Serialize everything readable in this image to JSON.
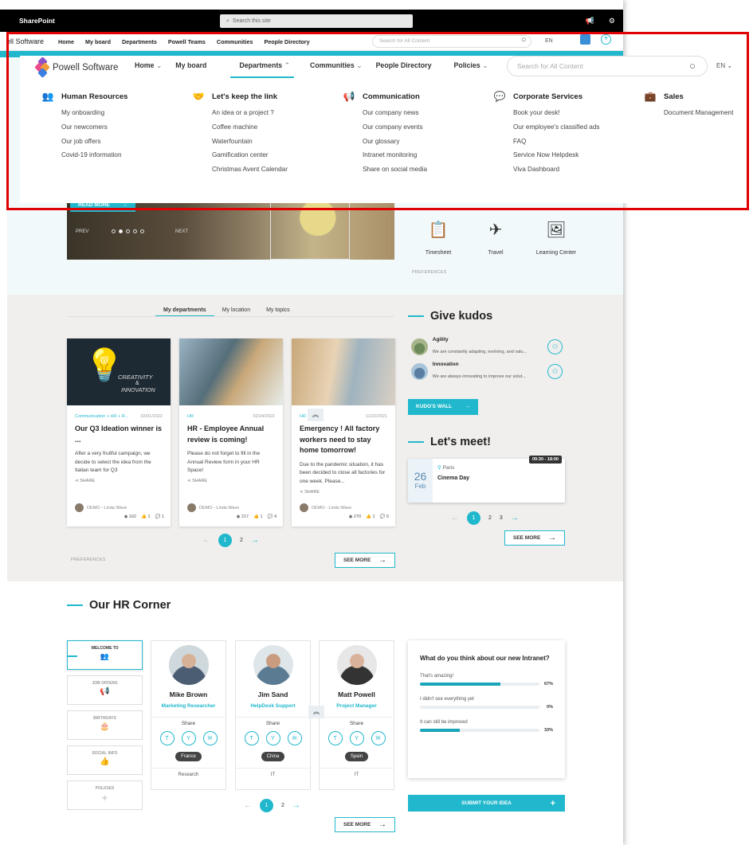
{
  "sharepoint": {
    "brand": "SharePoint",
    "search_placeholder": "Search this site"
  },
  "subnav": {
    "brand": "ell Software",
    "items": [
      "Home",
      "My board",
      "Departments",
      "Powell Teams",
      "Communities",
      "People Directory"
    ],
    "search_placeholder": "Search for All Content",
    "lang": "EN"
  },
  "menu": {
    "brand": "Powell Software",
    "nav": [
      {
        "label": "Home",
        "chev": true
      },
      {
        "label": "My board",
        "chev": false
      },
      {
        "label": "Departments",
        "chev": true
      },
      {
        "label": "Communities",
        "chev": true
      },
      {
        "label": "People Directory",
        "chev": false
      },
      {
        "label": "Policies",
        "chev": true
      }
    ],
    "search_placeholder": "Search for All Content",
    "lang": "EN",
    "columns": [
      {
        "title": "Human Resources",
        "icon": "people-icon",
        "items": [
          "My onboarding",
          "Our newcomers",
          "Our job offers",
          "Covid-19 information"
        ]
      },
      {
        "title": "Let's keep the link",
        "icon": "handshake-icon",
        "items": [
          "An idea or a project ?",
          "Coffee machine",
          "Waterfountain",
          "Gamification center",
          "Christmas Avent Calendar"
        ]
      },
      {
        "title": "Communication",
        "icon": "megaphone-icon",
        "items": [
          "Our company news",
          "Our company events",
          "Our glossary",
          "Intranet monitoring",
          "Share on social media"
        ]
      },
      {
        "title": "Corporate Services",
        "icon": "chat-icon",
        "items": [
          "Book your desk!",
          "Our employee's classified ads",
          "FAQ",
          "Service Now Helpdesk",
          "Viva Dashboard"
        ]
      },
      {
        "title": "Sales",
        "icon": "briefcase-icon",
        "items": [
          "Document Management"
        ]
      }
    ]
  },
  "hero": {
    "read_more": "READ MORE",
    "prev": "PREV",
    "next": "NEXT"
  },
  "quick_links": [
    "Timesheet",
    "Travel",
    "Learning Center"
  ],
  "preferences": "PREFERENCES",
  "news": {
    "tabs": [
      "My departments",
      "My location",
      "My topics"
    ],
    "cards": [
      {
        "cat": "Communication + HR + R...",
        "date": "02/01/2022",
        "title": "Our Q3 Ideation winner is ...",
        "excerpt": "After a very fruitful campaign, we decide to select the idea from the Italian team for Q3",
        "share": "SHARE",
        "author": "DEMO - Linda Wave",
        "views": "162",
        "likes": "1",
        "comments": "1"
      },
      {
        "cat": "HR",
        "date": "02/24/2022",
        "title": "HR - Employee Annual review is coming!",
        "excerpt": "Please do not forget to fill in the Annual Review form in your HR Space!",
        "share": "SHARE",
        "author": "DEMO - Linda Wave",
        "views": "217",
        "likes": "1",
        "comments": "4"
      },
      {
        "cat": "HR",
        "date": "11/22/2021",
        "title": "Emergency ! All factory workers need to stay home tomorrow!",
        "excerpt": "Due to the pandemic situation, it has been decided to close all factories for one week. Please...",
        "share": "SHARE",
        "author": "DEMO - Linda Wave",
        "views": "270",
        "likes": "1",
        "comments": "5"
      }
    ],
    "pages": [
      "1",
      "2"
    ],
    "see_more": "SEE MORE",
    "creativity_l1": "CREATIVITY",
    "creativity_l2": "&",
    "creativity_l3": "INNOVATION"
  },
  "kudos": {
    "title": "Give kudos",
    "items": [
      {
        "name": "Agility",
        "desc": "We are constantly adapting, evolving, and valu..."
      },
      {
        "name": "Innovation",
        "desc": "We are always innovating to improve our solut..."
      }
    ],
    "wall": "KUDO'S WALL"
  },
  "meet": {
    "title": "Let's meet!",
    "day": "26",
    "month": "Feb",
    "location": "Paris",
    "event": "Cinema Day",
    "time": "09:30 - 18:00",
    "pages": [
      "1",
      "2",
      "3"
    ],
    "see_more": "SEE MORE"
  },
  "hr": {
    "title": "Our HR Corner",
    "left": [
      "WELCOME TO",
      "JOB OFFERS",
      "BIRTHDAYS",
      "SOCIAL INFO",
      "POLICIES"
    ],
    "people": [
      {
        "name": "Mike Brown",
        "role": "Marketing Researcher",
        "share": "Share",
        "country": "France",
        "dept": "Research"
      },
      {
        "name": "Jim Sand",
        "role": "HelpDesk Support",
        "share": "Share",
        "country": "China",
        "dept": "IT"
      },
      {
        "name": "Matt Powell",
        "role": "Project Manager",
        "share": "Share",
        "country": "Spain",
        "dept": "IT"
      }
    ],
    "pages": [
      "1",
      "2"
    ],
    "see_more": "SEE MORE"
  },
  "survey": {
    "question": "What do you think about our new Intranet?",
    "options": [
      {
        "label": "That's amazing!",
        "pct": "67%",
        "value": 67
      },
      {
        "label": "I didn't see everything yet",
        "pct": "0%",
        "value": 0
      },
      {
        "label": "It can still be improved",
        "pct": "33%",
        "value": 33
      }
    ],
    "submit": "SUBMIT YOUR IDEA"
  },
  "colors": {
    "accent": "#21b8cd",
    "highlight": "#e00000"
  }
}
